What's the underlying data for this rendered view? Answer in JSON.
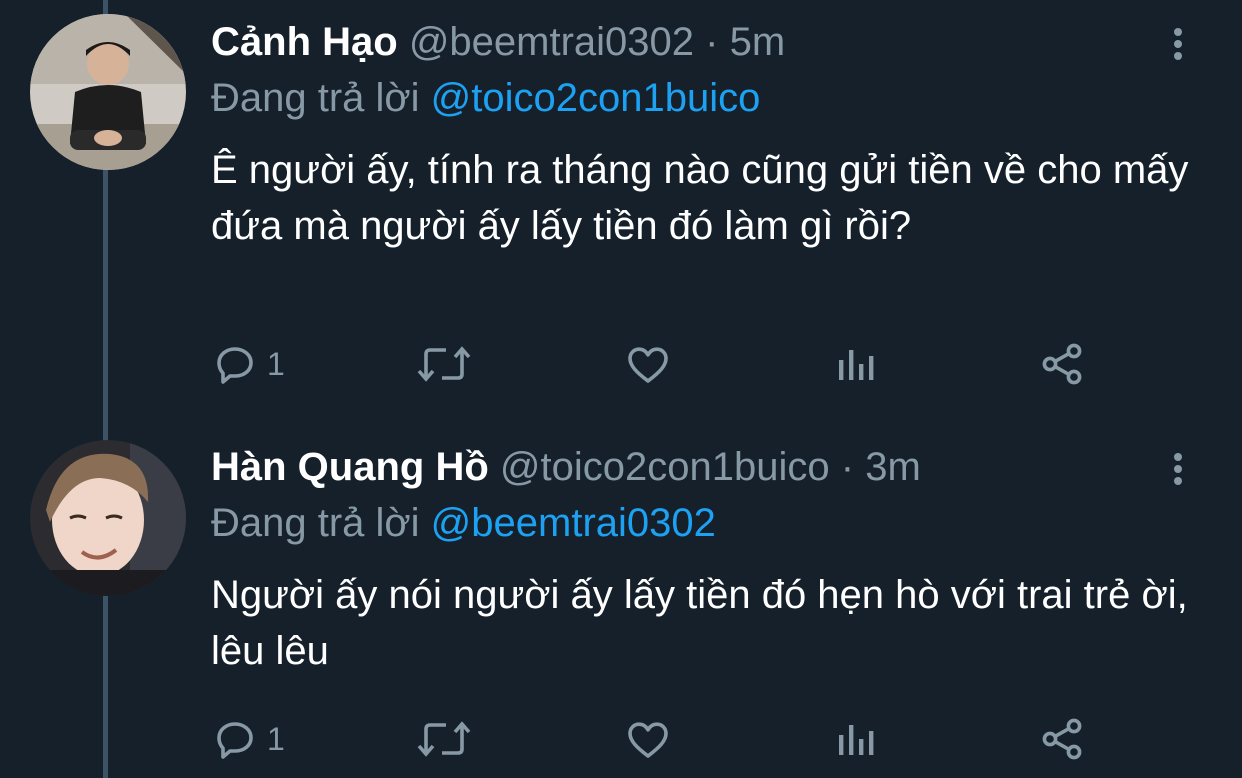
{
  "tweets": [
    {
      "name": "Cảnh Hạo",
      "handle": "@beemtrai0302",
      "separator": "·",
      "time": "5m",
      "replying_prefix": "Đang trả lời",
      "replying_to": "@toico2con1buico",
      "text": "Ê người ấy, tính ra tháng nào cũng gửi tiền về cho mấy đứa mà người ấy lấy tiền đó làm gì rồi?",
      "reply_count": "1",
      "icons": [
        "more-icon",
        "reply-icon",
        "retweet-icon",
        "like-icon",
        "stats-icon",
        "share-icon"
      ]
    },
    {
      "name": "Hàn Quang Hồ",
      "handle": "@toico2con1buico",
      "separator": "·",
      "time": "3m",
      "replying_prefix": "Đang trả lời",
      "replying_to": "@beemtrai0302",
      "text": "Người ấy nói người ấy lấy tiền đó hẹn hò với trai trẻ ời, lêu lêu",
      "reply_count": "1",
      "icons": [
        "more-icon",
        "reply-icon",
        "retweet-icon",
        "like-icon",
        "stats-icon",
        "share-icon"
      ]
    }
  ],
  "colors": {
    "background": "#15202b",
    "text_primary": "#ffffff",
    "text_secondary": "#8899a6",
    "link": "#1da1f2",
    "thread_line": "#3d5466"
  }
}
